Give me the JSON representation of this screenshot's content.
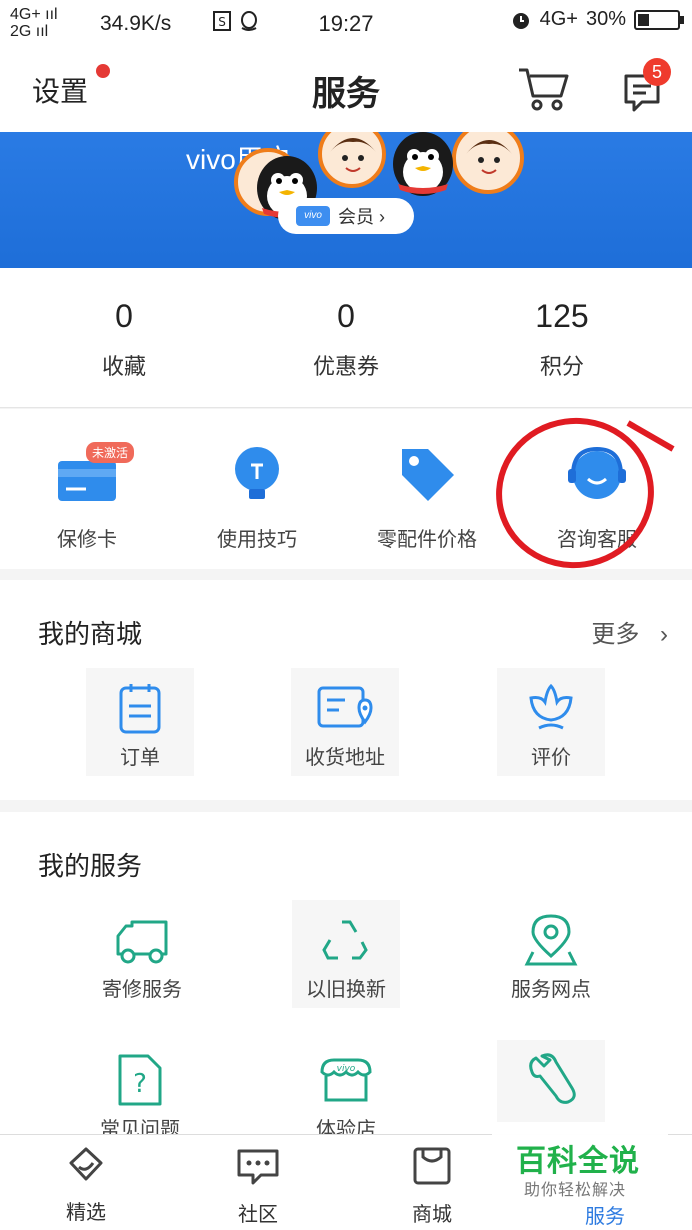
{
  "status_bar": {
    "network_1": "4G+ ııl",
    "network_2": "2G ııl",
    "speed": "34.9K/s",
    "time": "19:27",
    "network_right": "4G+",
    "battery_percent": "30%",
    "battery_level": 0.3
  },
  "header": {
    "settings_label": "设置",
    "title": "服务",
    "message_badge": "5"
  },
  "banner": {
    "title": "vivo用户",
    "member_chip": "vivo",
    "member_label": "会员 ›"
  },
  "stats": [
    {
      "value": "0",
      "label": "收藏"
    },
    {
      "value": "0",
      "label": "优惠券"
    },
    {
      "value": "125",
      "label": "积分"
    }
  ],
  "tools": {
    "items": [
      {
        "label": "保修卡",
        "icon": "warranty-card-icon"
      },
      {
        "label": "使用技巧",
        "icon": "lightbulb-icon"
      },
      {
        "label": "零配件价格",
        "icon": "price-tag-icon"
      },
      {
        "label": "咨询客服",
        "icon": "customer-service-icon"
      }
    ],
    "warranty_tag": "未激活"
  },
  "mall": {
    "title": "我的商城",
    "more": "更多",
    "items": [
      {
        "label": "订单",
        "icon": "order-clipboard-icon"
      },
      {
        "label": "收货地址",
        "icon": "address-card-icon"
      },
      {
        "label": "评价",
        "icon": "review-flower-icon"
      }
    ]
  },
  "services": {
    "title": "我的服务",
    "items": [
      {
        "label": "寄修服务",
        "icon": "truck-icon"
      },
      {
        "label": "以旧换新",
        "icon": "recycle-icon"
      },
      {
        "label": "服务网点",
        "icon": "location-pin-icon"
      },
      {
        "label": "常见问题",
        "icon": "faq-document-icon"
      },
      {
        "label": "体验店",
        "icon": "vivo-store-icon"
      },
      {
        "label": "",
        "icon": "wrench-icon"
      }
    ]
  },
  "tabbar": {
    "items": [
      {
        "label": "精选",
        "icon": "featured-icon"
      },
      {
        "label": "社区",
        "icon": "community-chat-icon"
      },
      {
        "label": "商城",
        "icon": "shop-bag-icon"
      },
      {
        "label": "服务",
        "icon": "service-icon"
      }
    ]
  },
  "watermark": {
    "title": "百科全说",
    "subtitle": "助你轻松解决"
  },
  "colors": {
    "accent_blue": "#1e6ed8",
    "service_green": "#21a787",
    "badge_red": "#ef3b2d",
    "annotation_red": "#e01b22"
  }
}
